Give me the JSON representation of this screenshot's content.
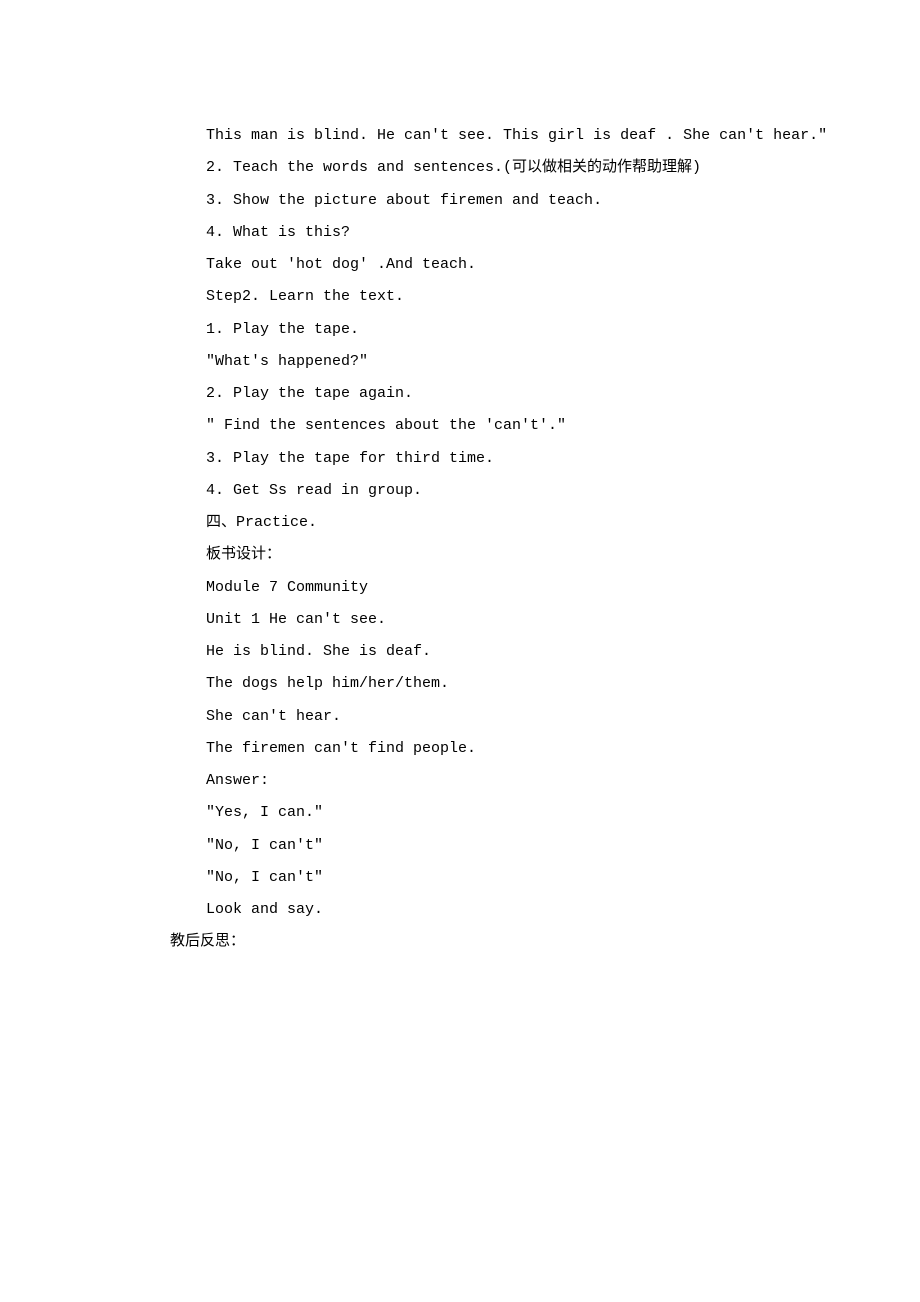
{
  "lines": {
    "l01": "This man is blind. He can't see.  This girl is deaf . She can't hear.\"",
    "l02": "2. Teach the words and sentences.(可以做相关的动作帮助理解)",
    "l03": "3. Show the picture about firemen and teach.",
    "l04": "4.  What is this?",
    "l05": "Take out 'hot dog' .And teach.",
    "l06": "Step2. Learn the text.",
    "l07": "1. Play the tape.",
    "l08": "\"What's happened?\"",
    "l09": "2. Play the tape again.",
    "l10": "\" Find the sentences about the 'can't'.\"",
    "l11": "3. Play the tape for third time.",
    "l12": "4. Get Ss read in group.",
    "l13": "四、Practice.",
    "l14": "板书设计：",
    "l15": "Module 7  Community",
    "l16": " Unit 1  He can't see.",
    "l17": "He is blind. She is deaf.",
    "l18": "The dogs help him/her/them.",
    "l19": "She can't hear.",
    "l20": "The firemen can't find people.",
    "l21": "Answer:",
    "l22": "\"Yes, I can.\"",
    "l23": "\"No, I can't\"",
    "l24": "\"No, I can't\"",
    "l25": "  Look and say.",
    "l26": "教后反思："
  }
}
